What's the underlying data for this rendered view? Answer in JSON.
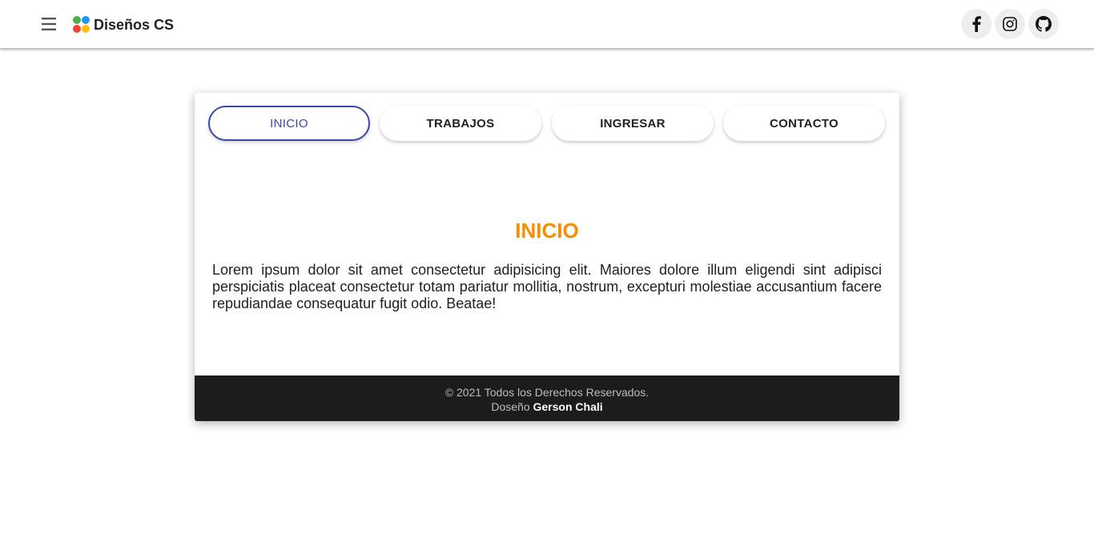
{
  "header": {
    "menu_icon": "hamburger-menu-icon",
    "brand": {
      "title": "Diseños CS",
      "logo_icon": "four-dots-logo-icon",
      "logo_colors": [
        "#4caf50",
        "#2196f3",
        "#f44336",
        "#ffc107"
      ]
    },
    "social": [
      {
        "name": "facebook",
        "icon": "facebook-icon"
      },
      {
        "name": "instagram",
        "icon": "instagram-icon"
      },
      {
        "name": "github",
        "icon": "github-icon"
      }
    ]
  },
  "tabs": [
    {
      "label": "INICIO",
      "active": true
    },
    {
      "label": "TRABAJOS",
      "active": false
    },
    {
      "label": "INGRESAR",
      "active": false
    },
    {
      "label": "CONTACTO",
      "active": false
    }
  ],
  "content": {
    "title": "INICIO",
    "text": "Lorem ipsum dolor sit amet consectetur adipisicing elit. Maiores dolore illum eligendi sint adipisci perspiciatis placeat consectetur totam pariatur mollitia, nostrum, excepturi molestiae accusantium facere repudiandae consequatur fugit odio. Beatae!"
  },
  "footer": {
    "copyright": "© 2021 Todos los Derechos Reservados.",
    "design_label": "Doseño",
    "designer": "Gerson Chali"
  },
  "colors": {
    "accent": "#3949ab",
    "title": "#fb8c00",
    "footer_bg": "#1c1c1c"
  }
}
